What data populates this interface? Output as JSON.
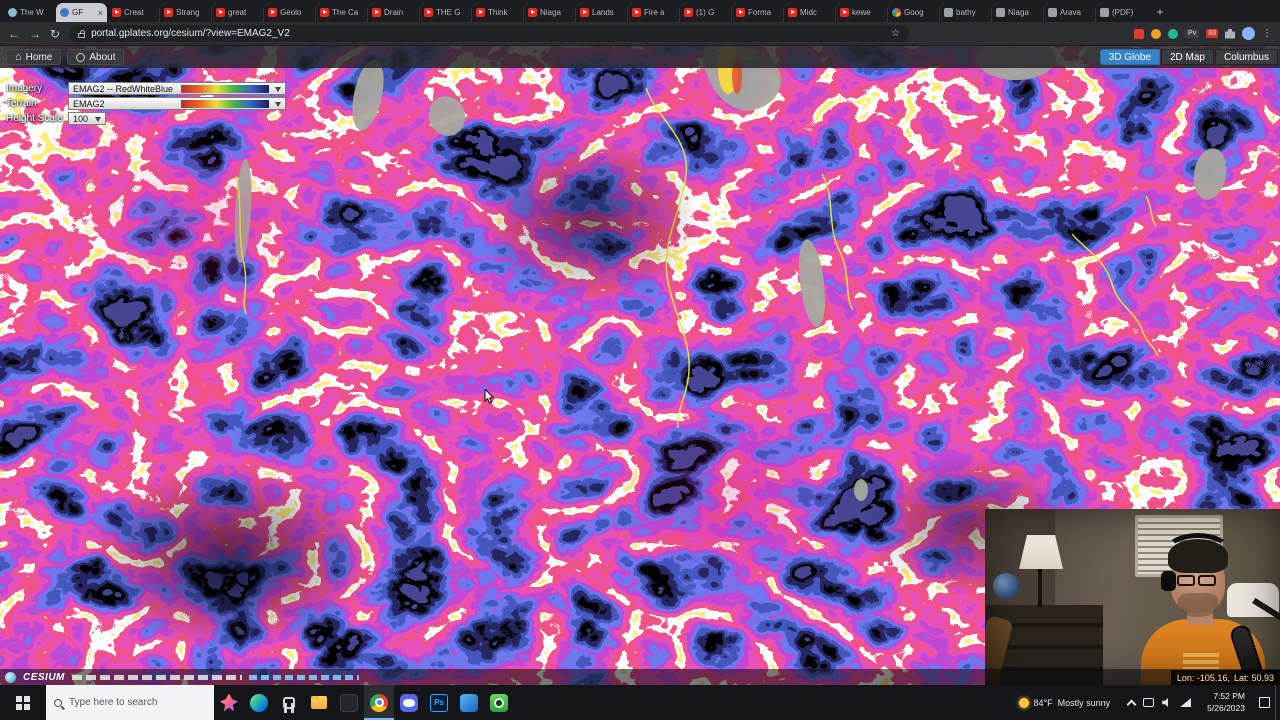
{
  "browser": {
    "new_tab_label": "+",
    "tabs": [
      {
        "label": "The W",
        "icon": "fv-globe"
      },
      {
        "label": "GF",
        "icon": "fv-gf",
        "active": true,
        "close": "×"
      },
      {
        "label": "Creat",
        "icon": "fv-youtube"
      },
      {
        "label": "Strang",
        "icon": "fv-youtube"
      },
      {
        "label": "great",
        "icon": "fv-youtube"
      },
      {
        "label": "Geolo",
        "icon": "fv-youtube"
      },
      {
        "label": "The Ca",
        "icon": "fv-youtube"
      },
      {
        "label": "Drain",
        "icon": "fv-youtube"
      },
      {
        "label": "THE G",
        "icon": "fv-youtube"
      },
      {
        "label": "Think",
        "icon": "fv-youtube"
      },
      {
        "label": "Niaga",
        "icon": "fv-youtube"
      },
      {
        "label": "Lands",
        "icon": "fv-youtube"
      },
      {
        "label": "Fire a",
        "icon": "fv-youtube"
      },
      {
        "label": "(1) G",
        "icon": "fv-youtube"
      },
      {
        "label": "Forma",
        "icon": "fv-youtube"
      },
      {
        "label": "Midc",
        "icon": "fv-youtube"
      },
      {
        "label": "kewe",
        "icon": "fv-youtube"
      },
      {
        "label": "Goog",
        "icon": "fv-google"
      },
      {
        "label": "bathy",
        "icon": "fv-page"
      },
      {
        "label": "Niaga",
        "icon": "fv-page"
      },
      {
        "label": "Arava",
        "icon": "fv-page"
      },
      {
        "label": "(PDF)",
        "icon": "fv-page"
      }
    ],
    "nav": {
      "url": "portal.gplates.org/cesium/?view=EMAG2_V2",
      "icons": {
        "back": "←",
        "forward": "→",
        "reload": "↻",
        "star": "☆",
        "home": "⌂"
      },
      "items": [
        {
          "name": "extension-red-icon",
          "cls": "nv-red"
        },
        {
          "name": "extension-orange-icon",
          "cls": "nv-orange"
        },
        {
          "name": "extension-teal-icon",
          "cls": "nv-teal"
        },
        {
          "name": "profile-chip",
          "cls": "nv-chip",
          "text": "Pv"
        },
        {
          "name": "extension-badge",
          "cls": "nv-badge",
          "text": "83"
        },
        {
          "name": "extensions-puzzle-icon",
          "cls": "nv-puzzle"
        },
        {
          "name": "profile-avatar",
          "cls": "nv-avatar"
        },
        {
          "name": "menu-kebab-icon",
          "cls": "nv-kebab",
          "text": "⋮"
        }
      ]
    }
  },
  "viewer": {
    "header": {
      "home_label": "Home",
      "about_label": "About",
      "views": [
        {
          "label": "3D Globe",
          "active": true
        },
        {
          "label": "2D Map"
        },
        {
          "label": "Columbus"
        }
      ]
    },
    "panel_rows": [
      {
        "label": "Imagery",
        "value": "EMAG2 -- RedWhiteBlue",
        "barcls": "cb"
      },
      {
        "label": "Terrain",
        "value": "EMAG2",
        "barcls": "cb"
      },
      {
        "label": "Height Scale",
        "value": "100"
      }
    ],
    "credit": {
      "logo": "CESIUM"
    },
    "coords": {
      "lon": "Lon: -105.16,",
      "lat": "Lat: 50.93"
    }
  },
  "taskbar": {
    "search_placeholder": "Type here to search",
    "apps": [
      {
        "name": "search-highlights-icon",
        "cls": "tb-highlights"
      },
      {
        "name": "edge-icon",
        "cls": "tb-edge"
      },
      {
        "name": "task-view-icon",
        "cls": "tb-taskview"
      },
      {
        "name": "file-explorer-icon",
        "cls": "tb-explorer"
      },
      {
        "name": "app-dark-icon",
        "cls": "tb-dark"
      },
      {
        "name": "chrome-icon",
        "cls": "tb-chrome",
        "active": true
      },
      {
        "name": "discord-icon",
        "cls": "tb-discord"
      },
      {
        "name": "photoshop-icon",
        "cls": "tb-ps",
        "text": "Ps"
      },
      {
        "name": "app-blue-icon",
        "cls": "tb-blue"
      },
      {
        "name": "camera-icon",
        "cls": "tb-camera"
      }
    ],
    "weather_temp": "84°F",
    "weather_desc": "Mostly sunny",
    "time": "7:52 PM",
    "date": "5/26/2023"
  },
  "colors": {
    "view_button_active": "#3583cb",
    "taskbar_underline": "#76b9ed",
    "map_border_yellow": "#e8e838",
    "lake_gray": "#a8a8a0",
    "youtube_red": "#e22b26",
    "shirt_orange": "#d97a1f"
  }
}
